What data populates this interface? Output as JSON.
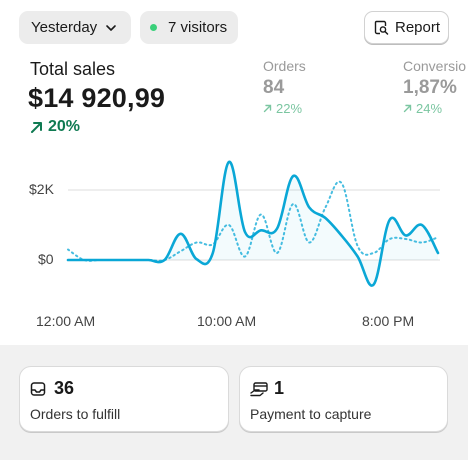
{
  "filters": {
    "date_label": "Yesterday",
    "visitors_label": "7 visitors",
    "visitor_dot_color": "#3ad07a"
  },
  "toolbar": {
    "report_label": "Report"
  },
  "total_sales": {
    "title": "Total sales",
    "value": "$14 920,99",
    "change": "20%",
    "change_color": "#0f7a52"
  },
  "orders": {
    "title": "Orders",
    "value": "84",
    "change": "22%"
  },
  "conversion": {
    "title": "Conversio",
    "value": "1,87%",
    "change": "24%"
  },
  "chart_data": {
    "type": "line",
    "y_tick_labels": [
      "$2K",
      "$0"
    ],
    "x_tick_labels": [
      "12:00 AM",
      "10:00 AM",
      "8:00 PM"
    ],
    "ylim": [
      -800,
      2900
    ],
    "grid": true,
    "series": [
      {
        "style": "solid",
        "color": "#0aa7d6",
        "x": [
          0,
          1,
          2,
          3,
          4,
          5,
          6,
          7,
          8,
          9,
          10,
          11,
          12,
          13,
          14,
          15,
          16,
          17,
          18,
          19,
          20,
          21,
          22,
          23
        ],
        "values": [
          0,
          0,
          0,
          0,
          0,
          0,
          0,
          750,
          20,
          200,
          2800,
          800,
          850,
          900,
          2400,
          1500,
          1200,
          700,
          100,
          -700,
          1150,
          700,
          1000,
          200
        ]
      },
      {
        "style": "dotted",
        "color": "#0aa7d6",
        "x": [
          0,
          1,
          2,
          3,
          4,
          5,
          6,
          7,
          8,
          9,
          10,
          11,
          12,
          13,
          14,
          15,
          16,
          17,
          18,
          19,
          20,
          21,
          22,
          23
        ],
        "values": [
          300,
          0,
          0,
          0,
          0,
          0,
          0,
          250,
          500,
          450,
          1000,
          100,
          1300,
          200,
          1600,
          500,
          1500,
          2200,
          400,
          200,
          600,
          600,
          500,
          650
        ]
      }
    ]
  },
  "cards": [
    {
      "count": "36",
      "label": "Orders to fulfill",
      "icon": "inbox-icon"
    },
    {
      "count": "1",
      "label": "Payment to capture",
      "icon": "payment-icon"
    }
  ]
}
